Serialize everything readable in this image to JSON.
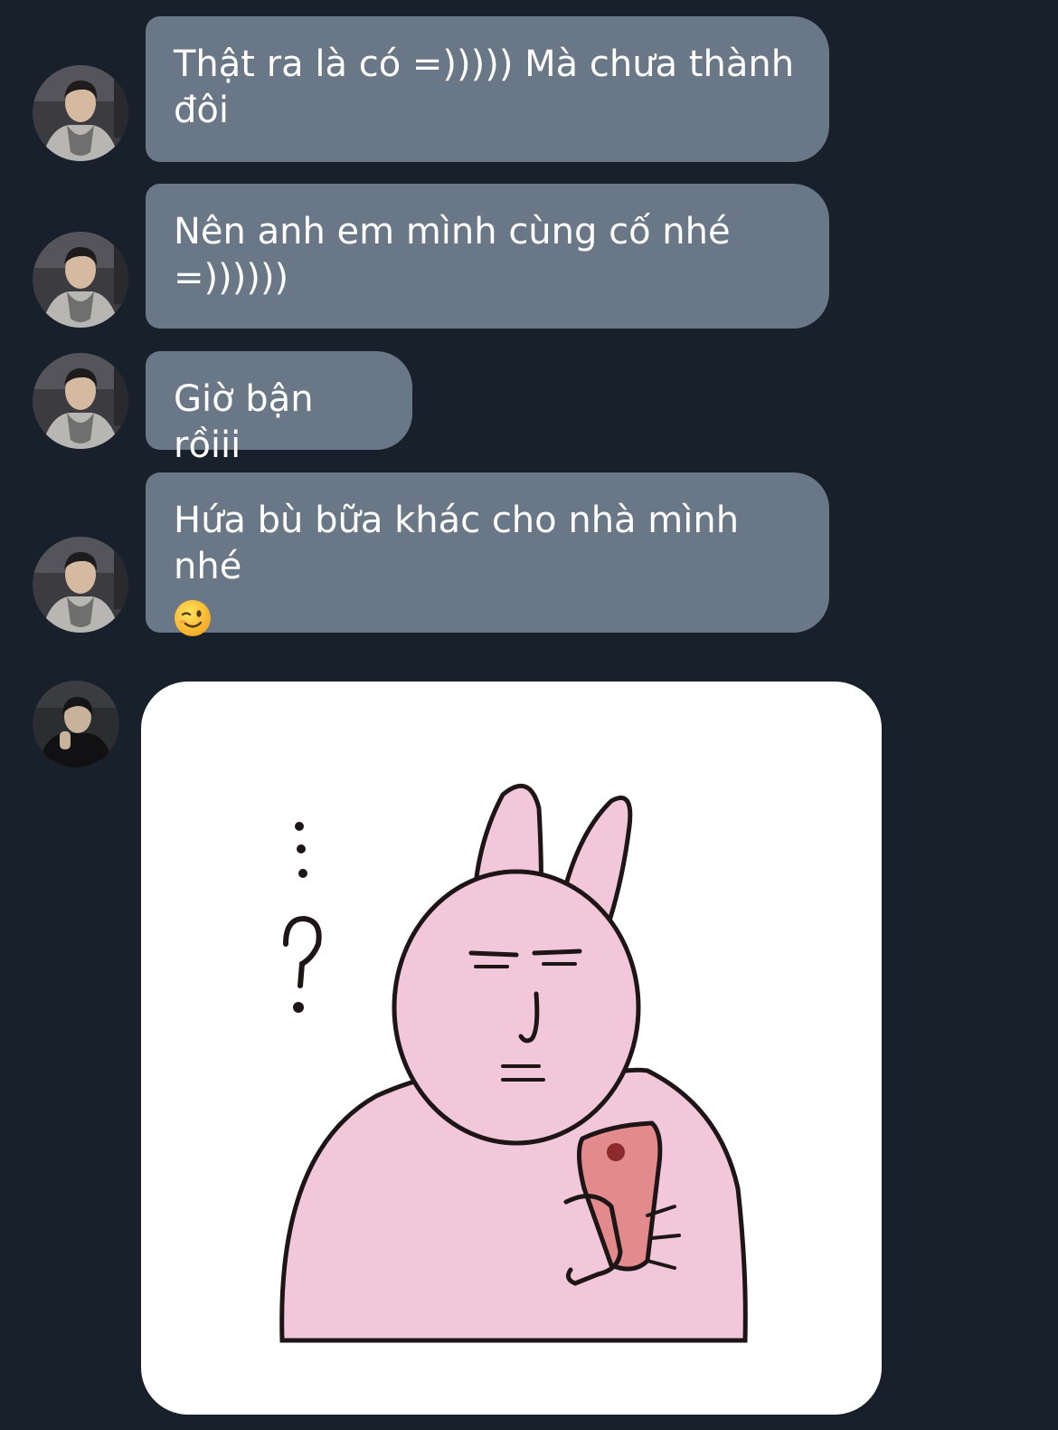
{
  "messages": [
    {
      "sender": "friend",
      "text": "Thật ra là có =))))) Mà chưa thành đôi"
    },
    {
      "sender": "friend",
      "text": "Nên anh em mình cùng cố nhé =))))))"
    },
    {
      "sender": "friend",
      "text": "Giờ bận rồiii"
    },
    {
      "sender": "friend",
      "text": "Hứa bù bữa khác cho nhà mình nhé",
      "emoji": "winking-face"
    },
    {
      "sender": "me",
      "type": "sticker",
      "sticker": "pink-bunny-holding-phone"
    }
  ],
  "colors": {
    "background": "#18202b",
    "bubble": "#6a7787",
    "bubble_text": "#ffffff",
    "sticker_bg": "#ffffff",
    "bunny_fill": "#f2c7da"
  }
}
